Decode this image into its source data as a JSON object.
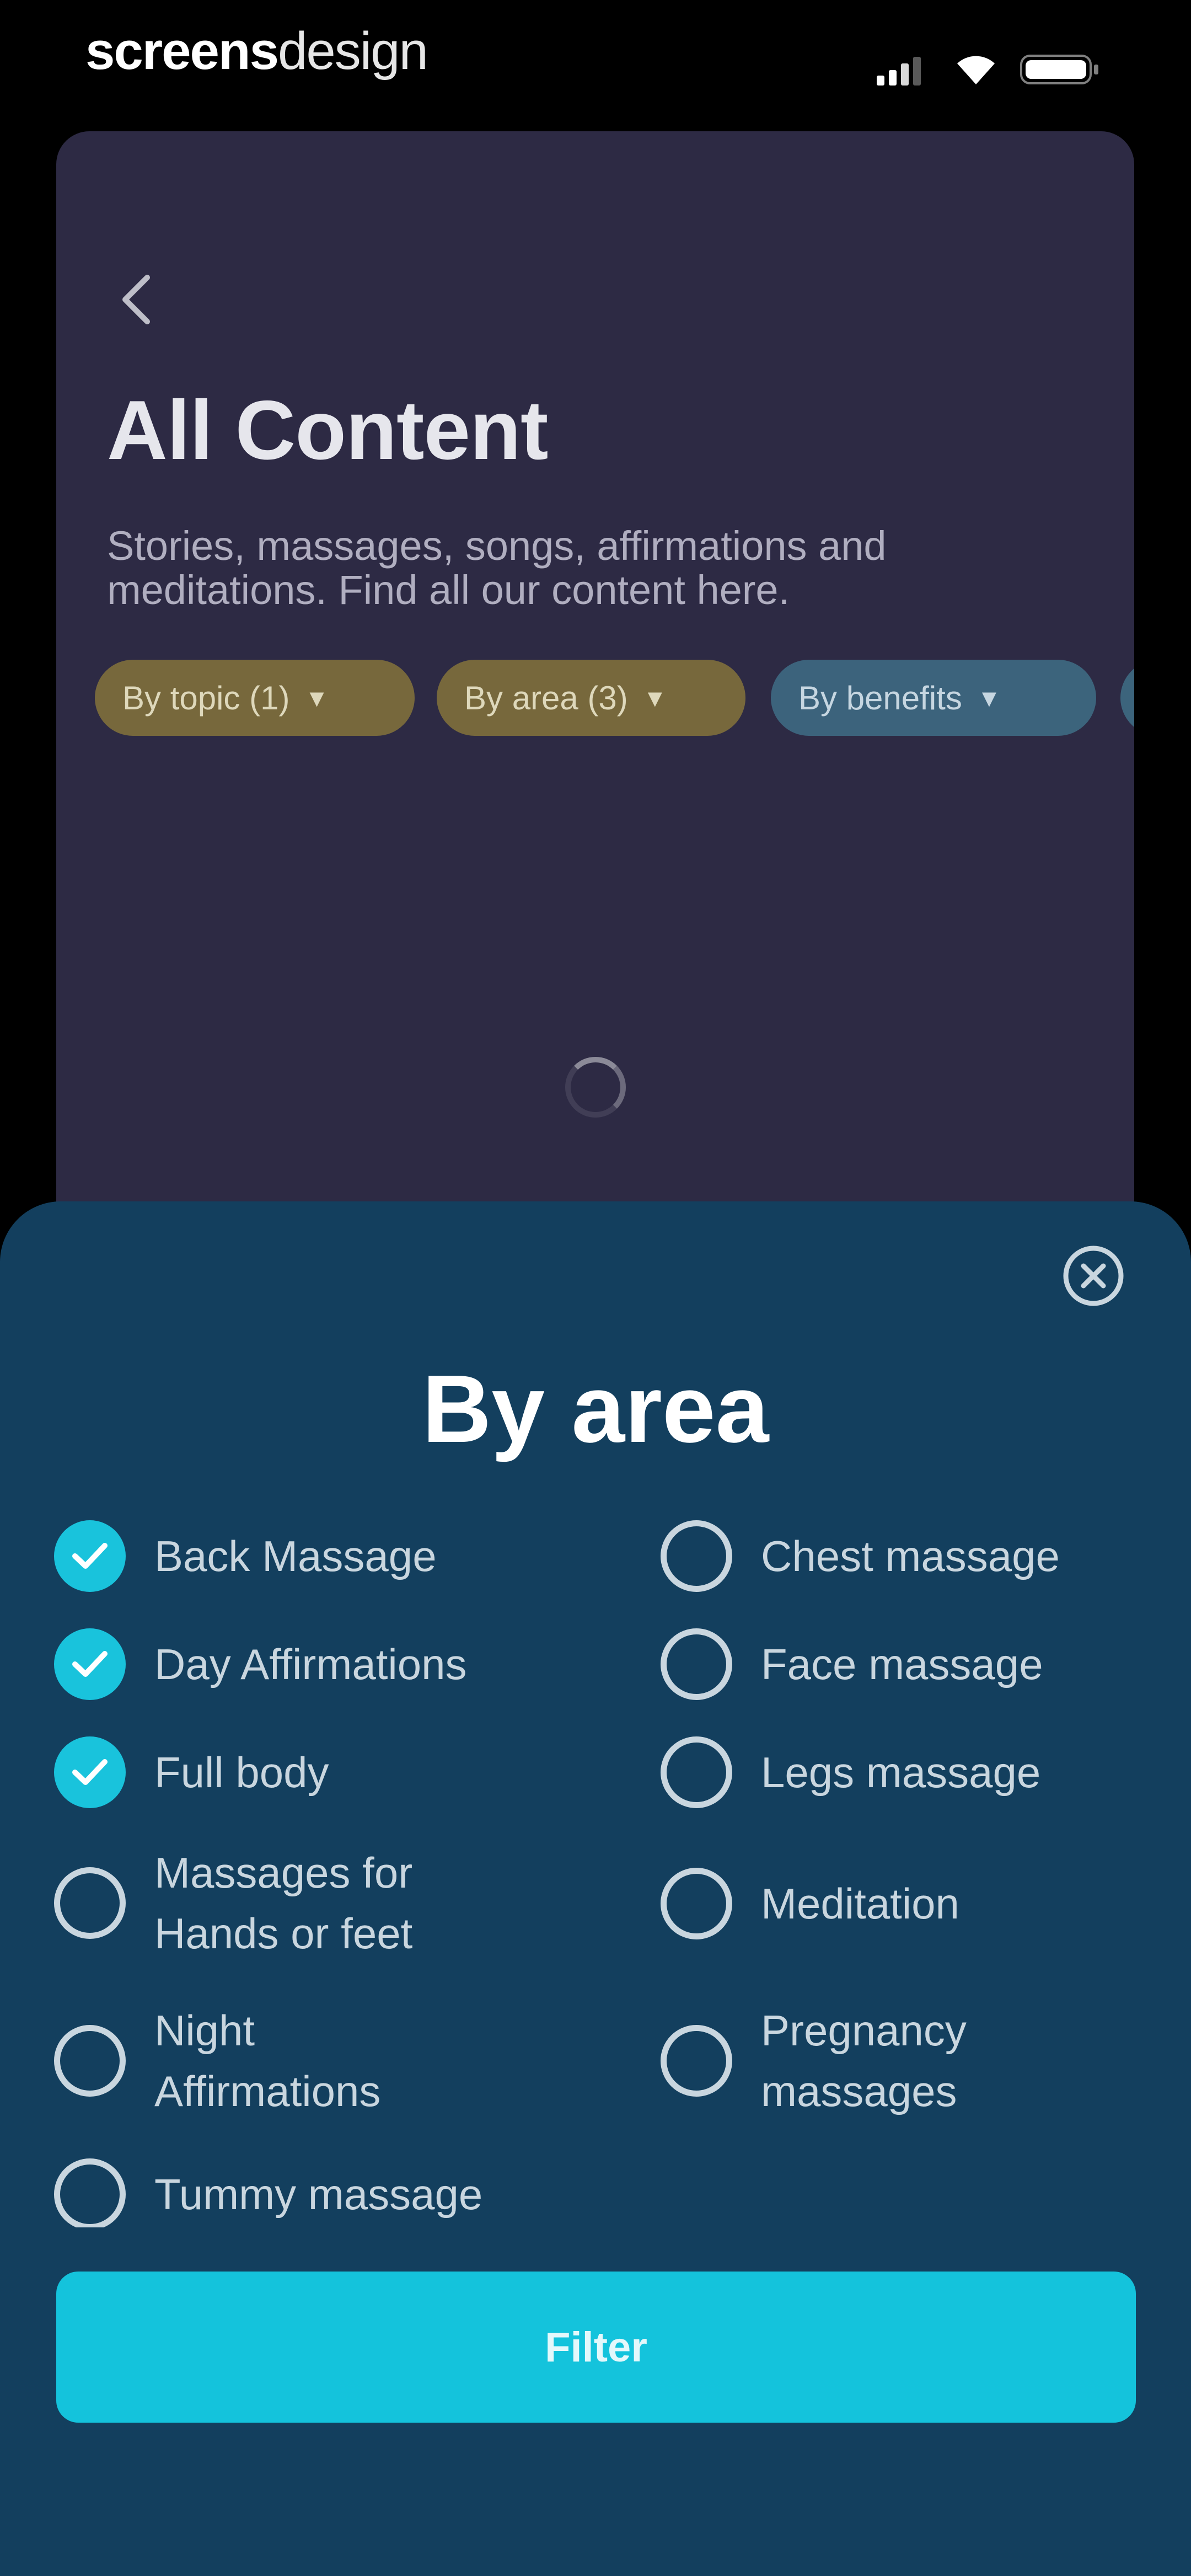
{
  "status_bar": {
    "brand_bold": "screens",
    "brand_light": "design",
    "icons": [
      "signal-icon",
      "wifi-icon",
      "battery-icon"
    ]
  },
  "background_screen": {
    "back_icon": "chevron-left-icon",
    "title": "All Content",
    "subtitle": "Stories, massages, songs, affirmations and meditations. Find all our content here.",
    "chips": [
      {
        "label": "By topic (1)",
        "active": true
      },
      {
        "label": "By area (3)",
        "active": true
      },
      {
        "label": "By benefits",
        "active": false
      }
    ],
    "chip_caret": "▾",
    "loading": true
  },
  "sheet": {
    "close_icon": "close-circle-icon",
    "title": "By area",
    "options_left": [
      {
        "label": "Back Massage",
        "checked": true
      },
      {
        "label": "Day Affirmations",
        "checked": true
      },
      {
        "label": "Full body",
        "checked": true
      },
      {
        "label": "Massages for Hands or feet",
        "checked": false
      },
      {
        "label": "Night Affirmations",
        "checked": false
      },
      {
        "label": "Tummy massage",
        "checked": false
      }
    ],
    "options_right": [
      {
        "label": "Chest massage",
        "checked": false
      },
      {
        "label": "Face massage",
        "checked": false
      },
      {
        "label": "Legs massage",
        "checked": false
      },
      {
        "label": "Meditation",
        "checked": false
      },
      {
        "label": "Pregnancy massages",
        "checked": false
      }
    ],
    "filter_label": "Filter"
  },
  "colors": {
    "background": "#000000",
    "card": "#2d2a44",
    "sheet": "#133f5e",
    "accent": "#19c3dc",
    "chip_gold": "#7b6c3c",
    "chip_blue": "#3d6780"
  }
}
